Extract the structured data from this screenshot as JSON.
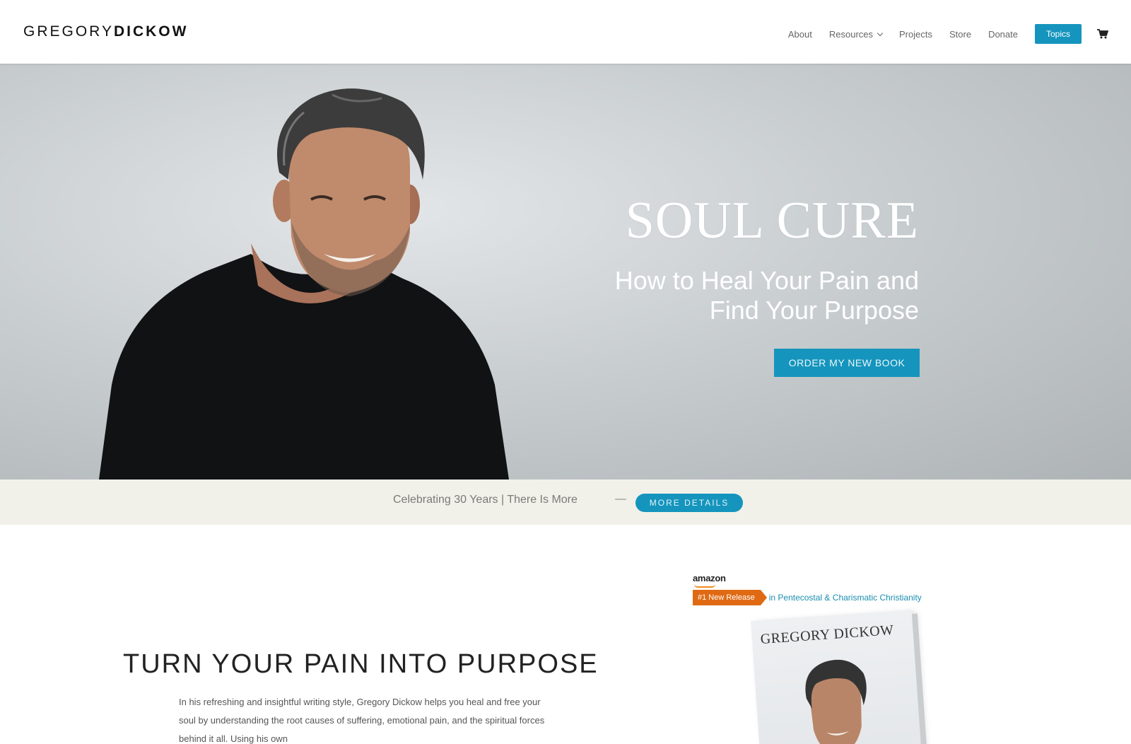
{
  "header": {
    "logo_light": "GREGORY",
    "logo_bold": "DICKOW",
    "nav": {
      "about": "About",
      "resources": "Resources",
      "projects": "Projects",
      "store": "Store",
      "donate": "Donate",
      "topics": "Topics"
    }
  },
  "hero": {
    "title": "SOUL CURE",
    "subtitle_line1": "How to Heal Your Pain and",
    "subtitle_line2": "Find Your Purpose",
    "cta": "ORDER MY NEW BOOK"
  },
  "announcement": {
    "text": "Celebrating 30 Years | There Is More",
    "dash": "—",
    "button": "MORE DETAILS"
  },
  "content": {
    "heading": "TURN YOUR PAIN INTO PURPOSE",
    "body": "In his refreshing and insightful writing style, Gregory Dickow helps you heal and free your soul by understanding the root causes of suffering, emotional pain, and the spiritual forces behind it all. Using his own"
  },
  "amazon": {
    "logo": "amazon",
    "badge": "#1 New Release",
    "category": "in Pentecostal & Charismatic Christianity"
  },
  "book": {
    "author": "GREGORY DICKOW"
  },
  "colors": {
    "accent": "#1595bd",
    "announcement_bg": "#f1f1e9",
    "amazon_badge": "#e06a13"
  }
}
